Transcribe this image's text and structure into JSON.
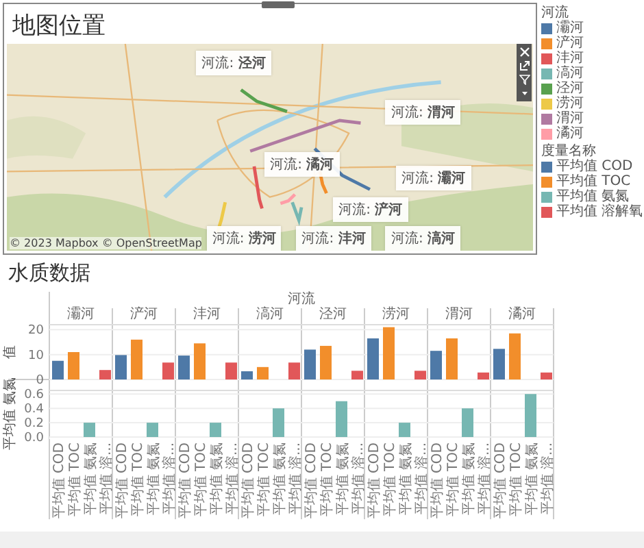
{
  "map_panel": {
    "title": "地图位置",
    "attribution": "© 2023 Mapbox © OpenStreetMap",
    "labels": [
      {
        "prefix": "河流:",
        "river": "泾河"
      },
      {
        "prefix": "河流:",
        "river": "渭河"
      },
      {
        "prefix": "河流:",
        "river": "潏河"
      },
      {
        "prefix": "河流:",
        "river": "灞河"
      },
      {
        "prefix": "河流:",
        "river": "浐河"
      },
      {
        "prefix": "河流:",
        "river": "涝河"
      },
      {
        "prefix": "河流:",
        "river": "沣河"
      },
      {
        "prefix": "河流:",
        "river": "滈河"
      }
    ]
  },
  "legend": {
    "river_title": "河流",
    "rivers": [
      {
        "name": "灞河",
        "color": "#4e79a7"
      },
      {
        "name": "浐河",
        "color": "#f28e2b"
      },
      {
        "name": "沣河",
        "color": "#e15759"
      },
      {
        "name": "滈河",
        "color": "#76b7b2"
      },
      {
        "name": "泾河",
        "color": "#59a14f"
      },
      {
        "name": "涝河",
        "color": "#edc948"
      },
      {
        "name": "渭河",
        "color": "#b07aa1"
      },
      {
        "name": "潏河",
        "color": "#ff9da7"
      }
    ],
    "measure_title": "度量名称",
    "measures": [
      {
        "name": "平均值 COD",
        "color": "#4e79a7"
      },
      {
        "name": "平均值 TOC",
        "color": "#f28e2b"
      },
      {
        "name": "平均值 氨氮",
        "color": "#76b7b2"
      },
      {
        "name": "平均值 溶解氧",
        "color": "#e15759"
      }
    ]
  },
  "water_panel": {
    "title": "水质数据",
    "column_header": "河流",
    "x_labels": [
      [
        "平均值 COD",
        "平均值 TOC",
        "平均值 氨氮",
        "平均值 溶..."
      ],
      [
        "平均值 COD",
        "平均值 TOC",
        "平均值 氨氮",
        "平均值 溶..."
      ],
      [
        "平均值 COD",
        "平均值 TOC",
        "平均值 氨氮",
        "平均值 溶..."
      ],
      [
        "平均值 COD",
        "平均值 TOC",
        "平均值 氨氮",
        "平均值 溶..."
      ],
      [
        "平均值 COD",
        "平均值 TOC",
        "平均值 氨氮",
        "平均值 溶..."
      ],
      [
        "平均值 COD",
        "平均值 TOC",
        "平均值 氨氮",
        "平均值 溶..."
      ],
      [
        "平均值 COD",
        "平均值 TOC",
        "平均值 氨氮",
        "平均值 溶..."
      ],
      [
        "平均值 COD",
        "平均值 TOC",
        "平均值 氨氮",
        "平均值 溶..."
      ]
    ],
    "facets": [
      "灞河",
      "浐河",
      "沣河",
      "滈河",
      "泾河",
      "涝河",
      "渭河",
      "潏河"
    ],
    "charts": [
      {
        "chart_data": {
          "type": "bar",
          "ylabel": "值",
          "ylim": [
            0,
            22
          ],
          "yticks": [
            0,
            10,
            20
          ],
          "grid": true,
          "series": [
            {
              "color": "#4e79a7",
              "values": [
                7.5,
                9.8,
                9.6,
                3.3,
                12,
                16.5,
                11.5,
                12.3
              ]
            },
            {
              "color": "#f28e2b",
              "values": [
                11,
                16,
                14.5,
                5,
                13.5,
                21,
                16.5,
                18.5
              ]
            },
            {
              "color": "#e15759",
              "values": [
                3.8,
                6.8,
                6.8,
                6.8,
                3.5,
                3.5,
                2.8,
                2.8
              ]
            }
          ]
        }
      },
      {
        "chart_data": {
          "type": "bar",
          "ylabel": "平均值 氨氮",
          "ylim": [
            0,
            0.65
          ],
          "grid": true,
          "yticks": [
            {
              "value": 0,
              "label": "0.0"
            },
            {
              "value": 0.2,
              "label": "0.2"
            },
            {
              "value": 0.4,
              "label": "0.4"
            },
            {
              "value": 0.6,
              "label": "0.6"
            }
          ],
          "series": [
            {
              "color": "#76b7b2",
              "values": [
                0.2,
                0.2,
                0.2,
                0.4,
                0.5,
                0.2,
                0.4,
                0.6
              ]
            }
          ]
        }
      }
    ]
  }
}
